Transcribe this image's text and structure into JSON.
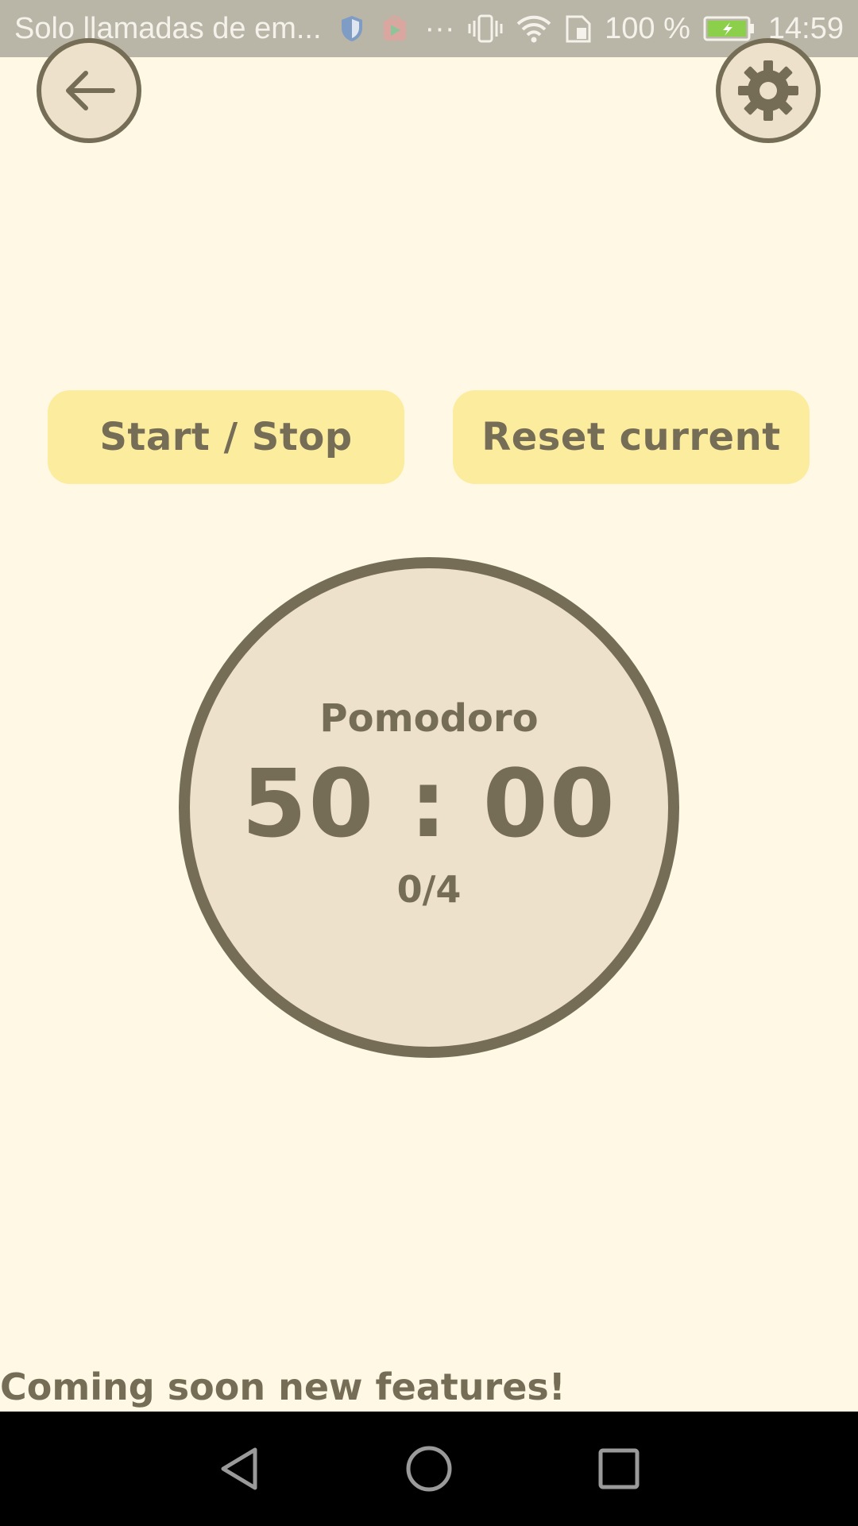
{
  "status_bar": {
    "notification_text": "Solo llamadas de em...",
    "overflow": "···",
    "battery_percent": "100 %",
    "time": "14:59",
    "icons": [
      "shield-icon",
      "play-store-icon",
      "vibrate-icon",
      "wifi-icon",
      "sim-icon",
      "battery-charging-icon"
    ]
  },
  "top_bar": {
    "back_icon": "arrow-left-icon",
    "settings_icon": "gear-icon"
  },
  "actions": {
    "start_stop_label": "Start / Stop",
    "reset_label": "Reset current"
  },
  "timer": {
    "session_label": "Pomodoro",
    "time": "50 : 00",
    "cycle_count": "0/4",
    "progress": 0
  },
  "footer": {
    "message": "Coming soon new features!"
  },
  "nav_bar": {
    "icons": [
      "nav-back-icon",
      "nav-home-icon",
      "nav-recents-icon"
    ]
  },
  "colors": {
    "background": "#fef8e4",
    "button": "#fcec9e",
    "circle_fill": "#ede1cb",
    "accent": "#756d56",
    "status_bar": "#b9b6a7"
  }
}
